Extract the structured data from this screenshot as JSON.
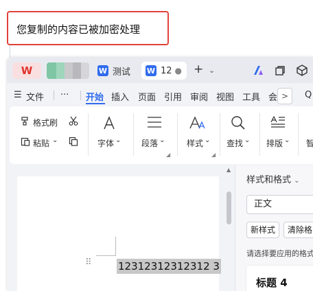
{
  "notice": {
    "text": "您复制的内容已被加密处理"
  },
  "titlebar": {
    "logo_glyph": "W",
    "tabs": [
      {
        "icon_letter": "W",
        "label": "测试"
      },
      {
        "icon_letter": "W",
        "label": "12",
        "modified_dot": "●"
      }
    ],
    "new_tab": "+",
    "dropdown": "⌄",
    "accent": "#2f6bed",
    "brand": "#e0332b"
  },
  "menu": {
    "hamburger": "☰",
    "file": "文件",
    "more": "···",
    "tabs": [
      "开始",
      "插入",
      "页面",
      "引用",
      "审阅",
      "视图",
      "工具",
      "会"
    ],
    "active_tab": "开始",
    "scroll_right": ">",
    "search": "Q"
  },
  "ribbon": {
    "format_painter": "格式刷",
    "paste": "粘贴",
    "font": "字体",
    "paragraph": "段落",
    "style": "样式",
    "find": "查找",
    "layout": "排版",
    "smart": "智",
    "caret": "⌄"
  },
  "document": {
    "selected_text": "12312312312312 3"
  },
  "styles_panel": {
    "title": "样式和格式",
    "current_style": "正文",
    "new_style_button": "新样式",
    "clear_format_button": "清除格",
    "hint": "请选择要应用的格式",
    "first_style": "标题 4"
  }
}
